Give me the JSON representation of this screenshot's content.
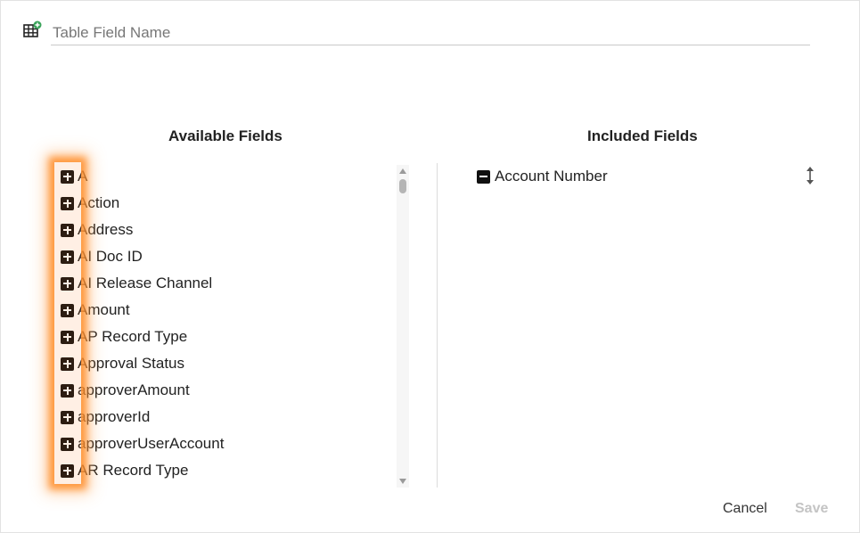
{
  "header": {
    "name_placeholder": "Table Field Name",
    "icon": "table-add-icon"
  },
  "available": {
    "title": "Available Fields",
    "items": [
      {
        "label": "A"
      },
      {
        "label": "Action"
      },
      {
        "label": "Address"
      },
      {
        "label": "AI Doc ID"
      },
      {
        "label": "AI Release Channel"
      },
      {
        "label": "Amount"
      },
      {
        "label": "AP Record Type"
      },
      {
        "label": "Approval Status"
      },
      {
        "label": "approverAmount"
      },
      {
        "label": "approverId"
      },
      {
        "label": "approverUserAccount"
      },
      {
        "label": "AR Record Type"
      }
    ]
  },
  "included": {
    "title": "Included Fields",
    "items": [
      {
        "label": "Account Number"
      }
    ]
  },
  "footer": {
    "cancel_label": "Cancel",
    "save_label": "Save"
  },
  "colors": {
    "highlight": "#ff8c28",
    "save_disabled": "#c4c4c4"
  }
}
